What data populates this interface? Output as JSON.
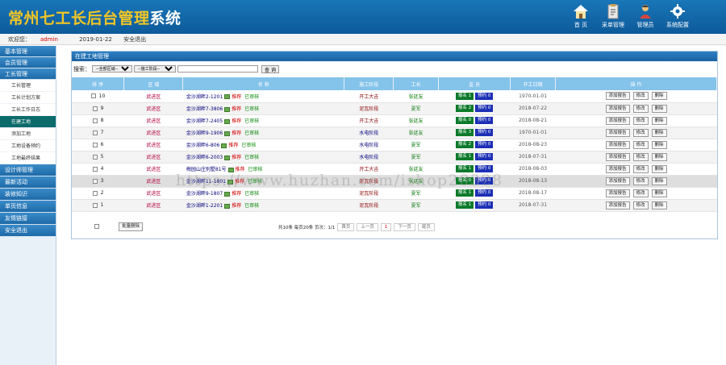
{
  "header": {
    "title_main": "常州七工长后台管理",
    "title_tail": "系统",
    "nav": [
      {
        "label": "首 页",
        "icon": "home-icon"
      },
      {
        "label": "采单管理",
        "icon": "clipboard-icon"
      },
      {
        "label": "管理员",
        "icon": "user-icon"
      },
      {
        "label": "系统配置",
        "icon": "gear-icon"
      }
    ]
  },
  "statusbar": {
    "user_prefix": "欢迎您：",
    "user": "admin",
    "date": "2019-01-22",
    "logout": "安全退出"
  },
  "sidebar": {
    "sections": [
      {
        "label": "基本管理"
      },
      {
        "label": "会员管理"
      },
      {
        "label": "工长管理",
        "children": [
          "工长管理",
          "工长计划方案",
          "工长工作日志",
          "在建工地",
          "添加工地",
          "工地设备预约",
          "工地最终结果"
        ]
      },
      {
        "label": "设计师管理"
      },
      {
        "label": "最新活动"
      },
      {
        "label": "装修知识"
      },
      {
        "label": "单页信息"
      },
      {
        "label": "友情链接"
      },
      {
        "label": "安全退出"
      }
    ],
    "active_child": "在建工地"
  },
  "panel": {
    "title": "在建工地管理",
    "search_label": "搜索：",
    "select1": "--全部区域--",
    "select2": "--施工阶段--",
    "search_button": "查 询",
    "columns": [
      "排 序",
      "区 域",
      "名 称",
      "施工阶段",
      "工长",
      "监 员",
      "开工日期",
      "操 作"
    ],
    "rows": [
      {
        "order": "10",
        "area": "武进区",
        "name": "金沙湖畔2-1201",
        "tag1": "推荐",
        "tag2": "已审核",
        "stage": "开工大吉",
        "stage_color": "red",
        "foreman": "张廷友",
        "b1": "报名 1",
        "b2": "预约 0",
        "date": "1970-01-01"
      },
      {
        "order": "9",
        "area": "武进区",
        "name": "金沙湖畔7-3806",
        "tag1": "推荐",
        "tag2": "已审核",
        "stage": "泥瓦阶段",
        "stage_color": "red",
        "foreman": "夏军",
        "b1": "报名 2",
        "b2": "预约 0",
        "date": "2018-07-22"
      },
      {
        "order": "8",
        "area": "武进区",
        "name": "金沙湖畔7-2405",
        "tag1": "推荐",
        "tag2": "已审核",
        "stage": "开工大吉",
        "stage_color": "red",
        "foreman": "张廷友",
        "b1": "报名 0",
        "b2": "预约 0",
        "date": "2018-08-21"
      },
      {
        "order": "7",
        "area": "武进区",
        "name": "金沙湖畔9-1906",
        "tag1": "推荐",
        "tag2": "已审核",
        "stage": "水电阶段",
        "stage_color": "blue",
        "foreman": "张廷友",
        "b1": "报名 3",
        "b2": "预约 0",
        "date": "1970-01-01"
      },
      {
        "order": "6",
        "area": "武进区",
        "name": "金沙湖畔6-806",
        "tag1": "推荐",
        "tag2": "已审核",
        "stage": "水电阶段",
        "stage_color": "blue",
        "foreman": "夏军",
        "b1": "报名 2",
        "b2": "预约 0",
        "date": "2018-08-23"
      },
      {
        "order": "5",
        "area": "武进区",
        "name": "金沙湖畔6-2003",
        "tag1": "推荐",
        "tag2": "已审核",
        "stage": "水电阶段",
        "stage_color": "blue",
        "foreman": "夏军",
        "b1": "报名 1",
        "b2": "预约 0",
        "date": "2018-07-31"
      },
      {
        "order": "4",
        "area": "武进区",
        "name": "梅园山庄别墅81号",
        "tag1": "推荐",
        "tag2": "已审核",
        "stage": "开工大吉",
        "stage_color": "red",
        "foreman": "张廷友",
        "b1": "报名 1",
        "b2": "预约 0",
        "date": "2018-08-03"
      },
      {
        "order": "3",
        "area": "武进区",
        "name": "金沙湖畔11-1801",
        "tag1": "推荐",
        "tag2": "已审核",
        "stage": "泥瓦阶段",
        "stage_color": "red",
        "foreman": "张廷友",
        "b1": "报名 0",
        "b2": "预约 0",
        "date": "2018-08-13"
      },
      {
        "order": "2",
        "area": "武进区",
        "name": "金沙湖畔9-1807",
        "tag1": "推荐",
        "tag2": "已审核",
        "stage": "泥瓦阶段",
        "stage_color": "red",
        "foreman": "夏军",
        "b1": "报名 1",
        "b2": "预约 0",
        "date": "2018-08-17"
      },
      {
        "order": "1",
        "area": "武进区",
        "name": "金沙湖畔1-2201",
        "tag1": "推荐",
        "tag2": "已审核",
        "stage": "泥瓦阶段",
        "stage_color": "red",
        "foreman": "夏军",
        "b1": "报名 1",
        "b2": "预约 0",
        "date": "2018-07-31"
      }
    ],
    "ops": [
      "添加报告",
      "修改",
      "删除"
    ],
    "batch_button": "批量删除",
    "pager": {
      "summary": "共10条 每页20条 页次：1/1",
      "first": "首页",
      "prev": "上一页",
      "current": "1",
      "next": "下一页",
      "last": "尾页"
    }
  },
  "watermark": "https://www.huzhan.com/ishop20328",
  "colors": {
    "header_bg": "#1269ad",
    "title_gold": "#f3c623",
    "table_head": "#84c3ea",
    "badge_green": "#0b7a2a",
    "badge_blue": "#1c2fb5"
  }
}
